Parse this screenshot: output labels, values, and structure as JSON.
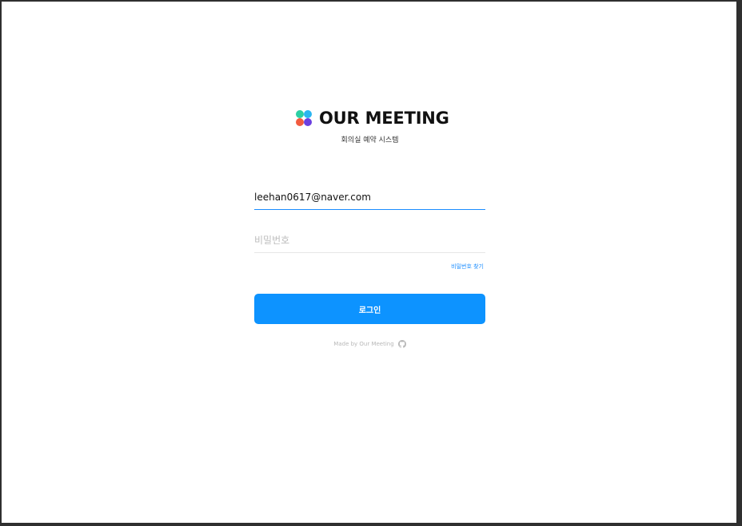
{
  "app": {
    "brand_name": "OUR MEETING",
    "subtitle": "회의실 예약 시스템"
  },
  "logo": {
    "icon": "four-dots-logo-icon",
    "dot_colors": [
      "#2ccfa4",
      "#2bb5f0",
      "#f25b3f",
      "#6b3fe0"
    ]
  },
  "login_form": {
    "email_value": "leehan0617@naver.com",
    "password_placeholder": "비밀번호",
    "find_password_label": "비밀번호 찾기",
    "submit_label": "로그인"
  },
  "footer": {
    "text": "Made by Our Meeting",
    "icon": "github-icon"
  },
  "colors": {
    "accent": "#1a8cff",
    "button": "#0d93ff",
    "placeholder": "#bdbdbd",
    "muted": "#b8b8b8"
  }
}
